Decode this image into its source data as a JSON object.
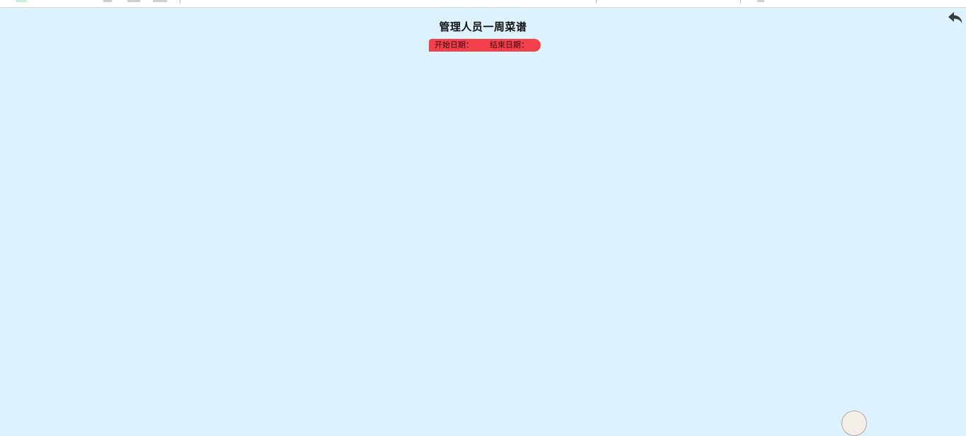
{
  "page": {
    "title": "管理人员一周菜谱",
    "start_date_label": "开始日期：",
    "start_date_value": "",
    "end_date_label": "结束日期：",
    "end_date_value": ""
  },
  "icons": {
    "back": "back-arrow-icon"
  },
  "colors": {
    "background": "#dcf2fe",
    "date_bar": "#f2414d",
    "title_text": "#111111"
  }
}
